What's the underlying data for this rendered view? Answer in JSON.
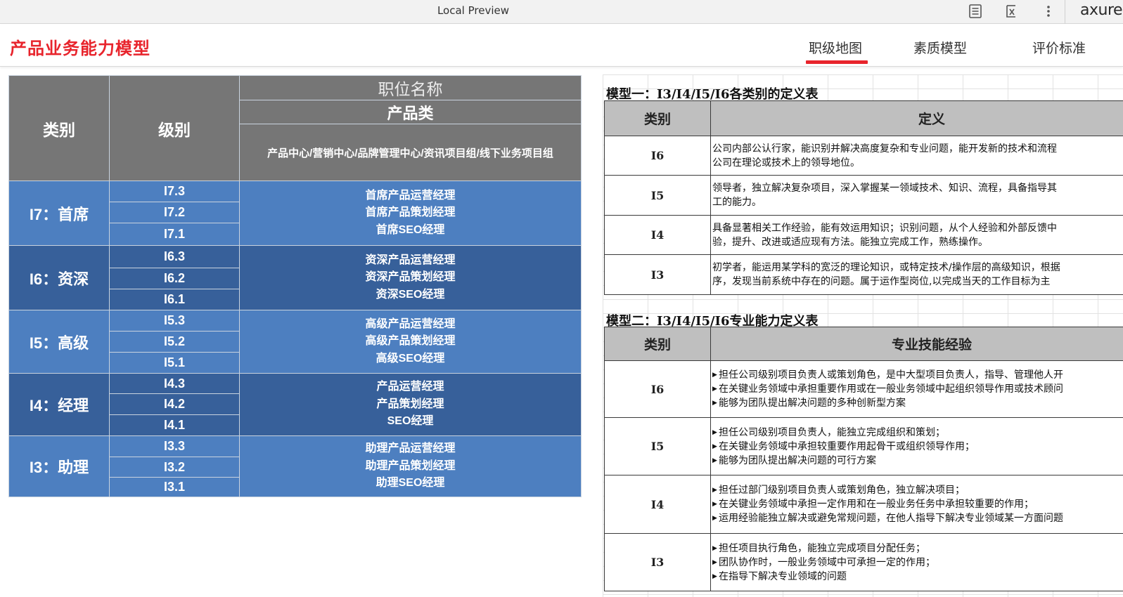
{
  "topbar": {
    "title": "Local Preview",
    "icons": [
      "document-lines-icon",
      "formula-icon",
      "more-vertical-icon"
    ],
    "brand": "axure"
  },
  "header": {
    "title": "产品业务能力模型",
    "tabs": [
      {
        "label": "职级地图",
        "active": true
      },
      {
        "label": "素质模型",
        "active": false
      },
      {
        "label": "评价标准",
        "active": false
      }
    ],
    "accent_color": "#e8242c"
  },
  "level_map": {
    "headers": {
      "category": "类别",
      "level": "级别",
      "job_title": "职位名称",
      "product_category": "产品类",
      "departments": "产品中心/营销中心/品牌管理中心/资讯项目组/线下业务项目组"
    },
    "groups": [
      {
        "category": "I7：首席",
        "levels": [
          "I7.3",
          "I7.2",
          "I7.1"
        ],
        "positions": [
          "首席产品运营经理",
          "首席产品策划经理",
          "首席SEO经理"
        ]
      },
      {
        "category": "I6：资深",
        "levels": [
          "I6.3",
          "I6.2",
          "I6.1"
        ],
        "positions": [
          "资深产品运营经理",
          "资深产品策划经理",
          "资深SEO经理"
        ]
      },
      {
        "category": "I5：高级",
        "levels": [
          "I5.3",
          "I5.2",
          "I5.1"
        ],
        "positions": [
          "高级产品运营经理",
          "高级产品策划经理",
          "高级SEO经理"
        ]
      },
      {
        "category": "I4：经理",
        "levels": [
          "I4.3",
          "I4.2",
          "I4.1"
        ],
        "positions": [
          "产品运营经理",
          "产品策划经理",
          "SEO经理"
        ]
      },
      {
        "category": "I3：助理",
        "levels": [
          "I3.3",
          "I3.2",
          "I3.1"
        ],
        "positions": [
          "助理产品运营经理",
          "助理产品策划经理",
          "助理SEO经理"
        ]
      }
    ],
    "colors": {
      "header": "#767676",
      "light": "#4d7fc0",
      "dark": "#37609a"
    }
  },
  "model1": {
    "title": "模型一：I3/I4/I5/I6各类别的定义表",
    "col_category": "类别",
    "col_definition": "定义",
    "rows": [
      {
        "level": "I6",
        "lines": [
          "公司内部公认行家，能识别并解决高度复杂和专业问题，能开发新的技术和流程",
          "公司在理论或技术上的领导地位。"
        ]
      },
      {
        "level": "I5",
        "lines": [
          "领导者，独立解决复杂项目，深入掌握某一领域技术、知识、流程，具备指导其",
          "工的能力。"
        ]
      },
      {
        "level": "I4",
        "lines": [
          "具备显著相关工作经验，能有效运用知识；识别问题，从个人经验和外部反馈中",
          "验，提升、改进或适应现有方法。能独立完成工作，熟练操作。"
        ]
      },
      {
        "level": "I3",
        "lines": [
          "初学者，能运用某学科的宽泛的理论知识，或特定技术/操作层的高级知识，根据",
          "序，发现当前系统中存在的问题。属于运作型岗位,以完成当天的工作目标为主"
        ]
      }
    ]
  },
  "model2": {
    "title": "模型二：I3/I4/I5/I6专业能力定义表",
    "col_category": "类别",
    "col_skills": "专业技能经验",
    "rows": [
      {
        "level": "I6",
        "lines": [
          "担任公司级别项目负责人或策划角色，是中大型项目负责人，指导、管理他人开",
          "在关键业务领域中承担重要作用或在一般业务领域中起组织领导作用或技术顾问",
          "能够为团队提出解决问题的多种创新型方案"
        ]
      },
      {
        "level": "I5",
        "lines": [
          "担任公司级别项目负责人，能独立完成组织和策划；",
          "在关键业务领域中承担较重要作用起骨干或组织领导作用；",
          "能够为团队提出解决问题的可行方案"
        ]
      },
      {
        "level": "I4",
        "lines": [
          "担任过部门级别项目负责人或策划角色，独立解决项目；",
          "在关键业务领域中承担一定作用和在一般业务任务中承担较重要的作用；",
          "运用经验能独立解决或避免常规问题，在他人指导下解决专业领域某一方面问题"
        ]
      },
      {
        "level": "I3",
        "lines": [
          "担任项目执行角色，能独立完成项目分配任务；",
          "团队协作时，一般业务领域中可承担一定的作用；",
          "在指导下解决专业领域的问题"
        ]
      }
    ]
  }
}
